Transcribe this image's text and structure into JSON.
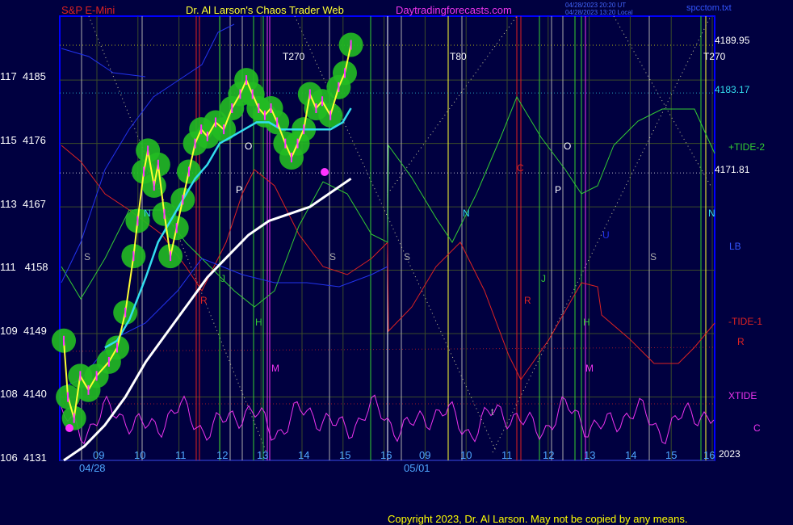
{
  "header": {
    "title_left": "S&P E-Mini",
    "title_center": "Dr. Al Larson's Chaos Trader Web",
    "site": "Daytradingforecasts.com",
    "time_stamp_1": "04/28/2023 20:20 UT",
    "time_stamp_2": "04/28/2023 13:20 Local",
    "file_name": "spcctom.txt"
  },
  "copyright": "Copyright 2023, Dr. Al Larson. May not be copied by any means.",
  "colors": {
    "background": "#000040",
    "frame": "#0000ff",
    "price_candles": "#ff33ff",
    "channel_glow": "#22bb22",
    "fast_ma": "#ffff33",
    "medium_ma": "#33ddee",
    "slow_ma": "#ffffff",
    "plus_tide": "#33cc33",
    "minus_tide": "#dd2222",
    "xtide": "#ee33ee",
    "lower_band": "#2233ee"
  },
  "right_labels": {
    "last_price": "4189.95",
    "level_cyan": "4183.17",
    "level_white": "4171.81",
    "plus_tide": "+TIDE-2",
    "n_marker": "N",
    "lb": "LB",
    "minus_tide": "-TIDE-1",
    "r_marker": "R",
    "xtide": "XTIDE",
    "c_marker": "C",
    "year": "2023"
  },
  "markers": {
    "t270_a": "T270",
    "t180": "T80",
    "t270_b": "T270",
    "s": "S",
    "n": "N",
    "o": "O",
    "p": "P",
    "j": "J",
    "h": "H",
    "m": "M",
    "r": "R",
    "c": "C",
    "u": "U",
    "t": "t"
  },
  "chart_data": {
    "type": "line",
    "title": "S&P E-Mini",
    "x_axis": {
      "ticks": [
        "09",
        "10",
        "11",
        "12",
        "13",
        "14",
        "15",
        "16",
        "09",
        "10",
        "11",
        "12",
        "13",
        "14",
        "15",
        "16"
      ],
      "date_labels": [
        "04/28",
        "05/01"
      ]
    },
    "y_axis": {
      "ticks": [
        {
          "label": "106",
          "value": 4131
        },
        {
          "label": "108",
          "value": 4140
        },
        {
          "label": "109",
          "value": 4149
        },
        {
          "label": "111",
          "value": 4158
        },
        {
          "label": "113",
          "value": 4167
        },
        {
          "label": "115",
          "value": 4176
        },
        {
          "label": "117",
          "value": 4185
        }
      ],
      "range": [
        4131,
        4195
      ]
    },
    "grid": true,
    "series": [
      {
        "name": "price",
        "points": [
          [
            0,
            4148
          ],
          [
            0.1,
            4140
          ],
          [
            0.25,
            4137
          ],
          [
            0.4,
            4143
          ],
          [
            0.6,
            4141
          ],
          [
            0.8,
            4143
          ],
          [
            1.1,
            4145
          ],
          [
            1.3,
            4147
          ],
          [
            1.5,
            4152
          ],
          [
            1.7,
            4160
          ],
          [
            1.8,
            4165
          ],
          [
            1.95,
            4172
          ],
          [
            2.05,
            4175
          ],
          [
            2.2,
            4170
          ],
          [
            2.3,
            4173
          ],
          [
            2.45,
            4166
          ],
          [
            2.6,
            4160
          ],
          [
            2.75,
            4164
          ],
          [
            2.9,
            4168
          ],
          [
            3.05,
            4172
          ],
          [
            3.2,
            4176
          ],
          [
            3.35,
            4178
          ],
          [
            3.5,
            4177
          ],
          [
            3.7,
            4179
          ],
          [
            3.9,
            4178
          ],
          [
            4.1,
            4181
          ],
          [
            4.3,
            4183
          ],
          [
            4.45,
            4185
          ],
          [
            4.6,
            4183
          ],
          [
            4.75,
            4181
          ],
          [
            4.9,
            4180
          ],
          [
            5.05,
            4181
          ],
          [
            5.2,
            4179
          ],
          [
            5.4,
            4176
          ],
          [
            5.55,
            4174
          ],
          [
            5.7,
            4176
          ],
          [
            5.85,
            4178
          ],
          [
            6.0,
            4183
          ],
          [
            6.15,
            4181
          ],
          [
            6.3,
            4182
          ],
          [
            6.5,
            4180
          ],
          [
            6.7,
            4184
          ],
          [
            6.85,
            4186
          ],
          [
            7.0,
            4190
          ]
        ]
      },
      {
        "name": "medium_ma",
        "points": [
          [
            1.0,
            4147
          ],
          [
            1.3,
            4148
          ],
          [
            1.6,
            4151
          ],
          [
            2.0,
            4157
          ],
          [
            2.3,
            4162
          ],
          [
            2.6,
            4165
          ],
          [
            2.9,
            4168
          ],
          [
            3.2,
            4171
          ],
          [
            3.5,
            4173
          ],
          [
            3.8,
            4176
          ],
          [
            4.1,
            4177
          ],
          [
            4.4,
            4178
          ],
          [
            4.7,
            4179
          ],
          [
            5.0,
            4179
          ],
          [
            5.3,
            4178
          ],
          [
            5.6,
            4178
          ],
          [
            5.9,
            4178
          ],
          [
            6.2,
            4178
          ],
          [
            6.5,
            4178
          ],
          [
            6.8,
            4179
          ],
          [
            7.0,
            4181
          ]
        ]
      },
      {
        "name": "slow_ma",
        "points": [
          [
            0,
            4131
          ],
          [
            0.5,
            4133
          ],
          [
            1.0,
            4136
          ],
          [
            1.5,
            4140
          ],
          [
            2.0,
            4145
          ],
          [
            2.5,
            4149
          ],
          [
            3.0,
            4153
          ],
          [
            3.5,
            4157
          ],
          [
            4.0,
            4160
          ],
          [
            4.5,
            4163
          ],
          [
            5.0,
            4165
          ],
          [
            5.5,
            4166
          ],
          [
            6.0,
            4167
          ],
          [
            6.5,
            4169
          ],
          [
            7.0,
            4171
          ]
        ]
      },
      {
        "name": "+TIDE-2",
        "values": []
      },
      {
        "name": "-TIDE-1",
        "values": []
      },
      {
        "name": "XTIDE",
        "values": []
      }
    ],
    "levels": [
      {
        "value": 4189.95,
        "color": "#ffff00"
      },
      {
        "value": 4183.17,
        "color": "#33ddee"
      },
      {
        "value": 4171.81,
        "color": "#ffffff"
      }
    ]
  }
}
